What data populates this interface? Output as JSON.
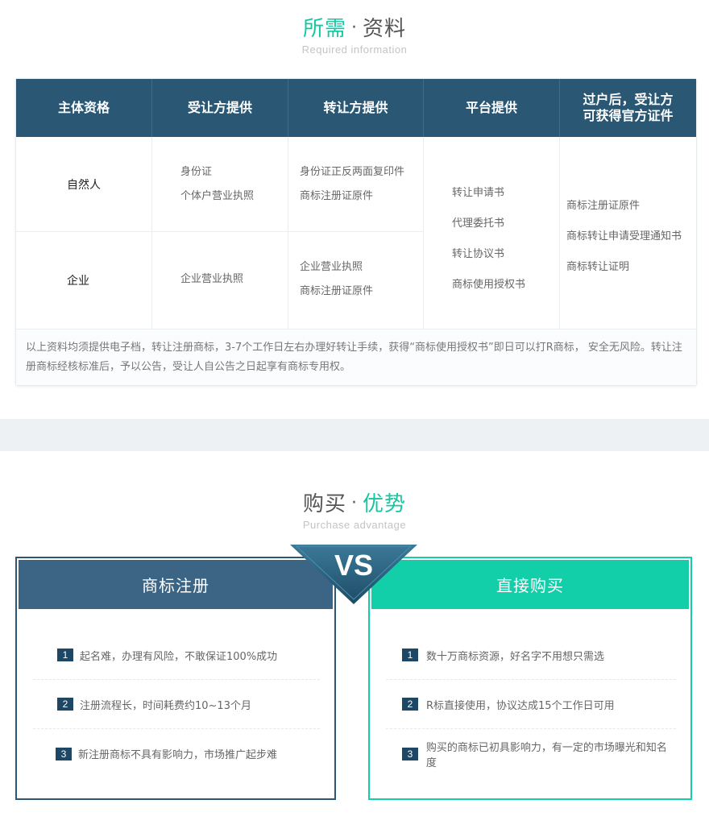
{
  "requirements": {
    "title_part1": "所需",
    "title_dot": "·",
    "title_part2": "资料",
    "subtitle": "Required information",
    "headers": [
      "主体资格",
      "受让方提供",
      "转让方提供",
      "平台提供",
      "过户后，受让方",
      "可获得官方证件"
    ],
    "rows": {
      "natural": {
        "subject": "自然人",
        "assignee": [
          "身份证",
          "个体户营业执照"
        ],
        "assignor": [
          "身份证正反两面复印件",
          "商标注册证原件"
        ]
      },
      "enterprise": {
        "subject": "企业",
        "assignee": [
          "企业营业执照"
        ],
        "assignor": [
          "企业营业执照",
          "商标注册证原件"
        ]
      }
    },
    "platform": [
      "转让申请书",
      "代理委托书",
      "转让协议书",
      "商标使用授权书"
    ],
    "official": [
      "商标注册证原件",
      "商标转让申请受理通知书",
      "商标转让证明"
    ],
    "note": "以上资料均须提供电子档，转让注册商标，3-7个工作日左右办理好转让手续，获得“商标使用授权书”即日可以打R商标， 安全无风险。转让注册商标经核标准后，予以公告，受让人自公告之日起享有商标专用权。"
  },
  "advantage": {
    "title_part1": "购买",
    "title_dot": "·",
    "title_part2": "优势",
    "subtitle": "Purchase advantage",
    "vs_label": "VS",
    "left": {
      "title": "商标注册",
      "items": [
        {
          "num": "1",
          "text": "起名难，办理有风险，不敢保证100%成功"
        },
        {
          "num": "2",
          "text": "注册流程长，时间耗费约10~13个月"
        },
        {
          "num": "3",
          "text": "新注册商标不具有影响力，市场推广起步难"
        }
      ]
    },
    "right": {
      "title": "直接购买",
      "items": [
        {
          "num": "1",
          "text": "数十万商标资源，好名字不用想只需选"
        },
        {
          "num": "2",
          "text": "R标直接使用，协议达成15个工作日可用"
        },
        {
          "num": "3",
          "text": "购买的商标已初具影响力，有一定的市场曝光和知名度"
        }
      ]
    }
  },
  "colors": {
    "navy": "#2a5874",
    "teal": "#13cfa9",
    "green_title": "#13c7a2"
  }
}
